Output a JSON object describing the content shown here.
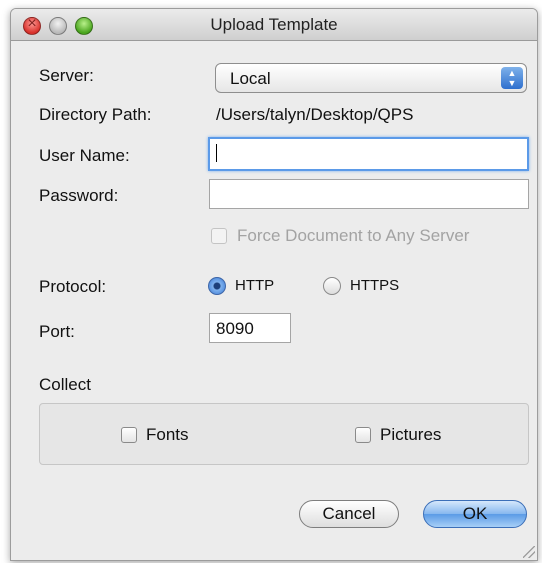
{
  "window": {
    "title": "Upload Template"
  },
  "form": {
    "server": {
      "label": "Server:",
      "value": "Local"
    },
    "directory": {
      "label": "Directory Path:",
      "value": "/Users/talyn/Desktop/QPS"
    },
    "username": {
      "label": "User Name:",
      "value": ""
    },
    "password": {
      "label": "Password:",
      "value": ""
    },
    "force_document": {
      "label": "Force Document to Any Server",
      "checked": false,
      "enabled": false
    },
    "protocol": {
      "label": "Protocol:",
      "options": [
        {
          "label": "HTTP",
          "selected": true
        },
        {
          "label": "HTTPS",
          "selected": false
        }
      ]
    },
    "port": {
      "label": "Port:",
      "value": "8090"
    }
  },
  "collect": {
    "label": "Collect",
    "fonts": {
      "label": "Fonts",
      "checked": false
    },
    "pictures": {
      "label": "Pictures",
      "checked": false
    }
  },
  "buttons": {
    "cancel": "Cancel",
    "ok": "OK"
  },
  "colors": {
    "accent": "#5b9be6",
    "close": "#d8322c",
    "zoom": "#4aa51e"
  },
  "icons": {
    "close": "close-icon",
    "minimize": "minimize-icon",
    "zoom": "zoom-icon",
    "stepper": "up-down-chevron-icon",
    "resize": "resize-grip-icon"
  }
}
